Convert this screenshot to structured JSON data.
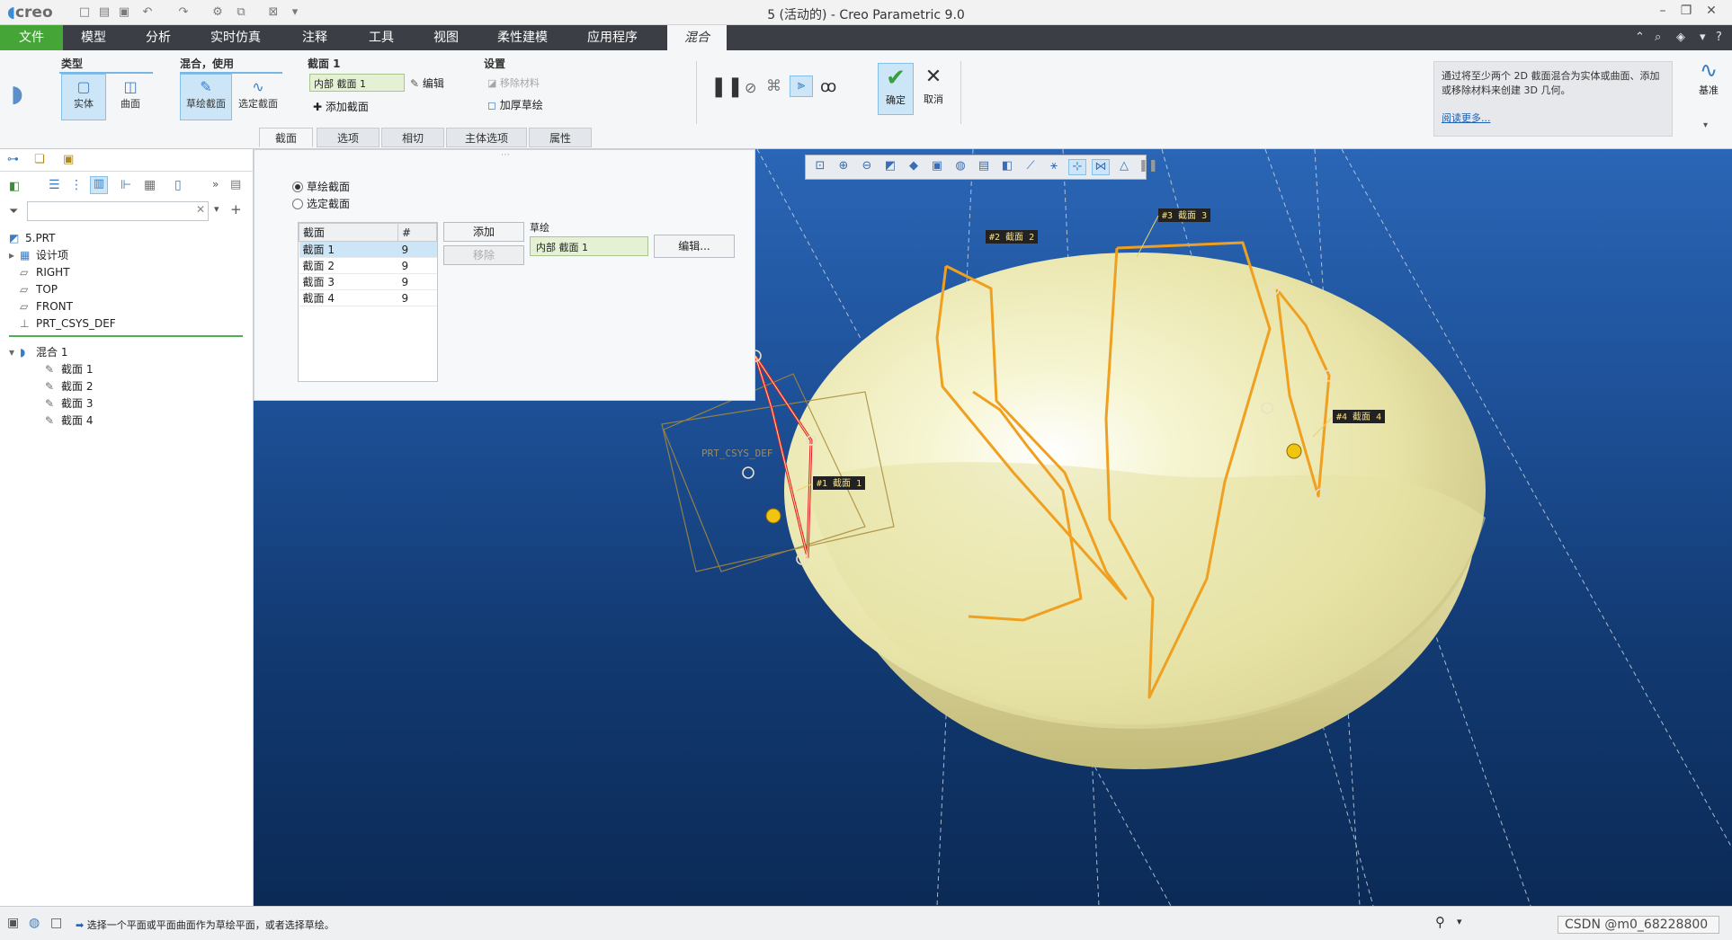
{
  "window": {
    "logo": "creo",
    "title": "5 (活动的) - Creo Parametric 9.0"
  },
  "menubar": {
    "items": [
      "文件",
      "模型",
      "分析",
      "实时仿真",
      "注释",
      "工具",
      "视图",
      "柔性建模",
      "应用程序",
      "混合"
    ],
    "active_index": 9
  },
  "ribbon": {
    "type_group": {
      "title": "类型",
      "solid": "实体",
      "surface": "曲面"
    },
    "blend_group": {
      "title": "混合，使用",
      "sketched": "草绘截面",
      "selected": "选定截面"
    },
    "section_group": {
      "title": "截面 1",
      "field_value": "内部 截面 1",
      "edit": "编辑",
      "add_section": "添加截面"
    },
    "settings_group": {
      "title": "设置",
      "remove_material": "移除材料",
      "thicken_sketch": "加厚草绘"
    },
    "confirm": "确定",
    "cancel": "取消",
    "help": {
      "text": "通过将至少两个 2D 截面混合为实体或曲面、添加或移除材料来创建 3D 几何。",
      "link": "阅读更多..."
    },
    "datum": "基准",
    "subtabs": [
      "截面",
      "选项",
      "相切",
      "主体选项",
      "属性"
    ],
    "subtab_active": 0
  },
  "model_tree": {
    "filter_placeholder": "",
    "items": [
      {
        "label": "5.PRT",
        "icon": "part-icon",
        "level": 0
      },
      {
        "label": "设计项",
        "icon": "design-items-icon",
        "level": 1
      },
      {
        "label": "RIGHT",
        "icon": "datum-plane-icon",
        "level": 1
      },
      {
        "label": "TOP",
        "icon": "datum-plane-icon",
        "level": 1
      },
      {
        "label": "FRONT",
        "icon": "datum-plane-icon",
        "level": 1
      },
      {
        "label": "PRT_CSYS_DEF",
        "icon": "csys-icon",
        "level": 1
      },
      {
        "label": "混合 1",
        "icon": "blend-icon",
        "level": 1
      },
      {
        "label": "截面 1",
        "icon": "sketch-icon",
        "level": 2
      },
      {
        "label": "截面 2",
        "icon": "sketch-icon",
        "level": 2
      },
      {
        "label": "截面 3",
        "icon": "sketch-icon",
        "level": 2
      },
      {
        "label": "截面 4",
        "icon": "sketch-icon",
        "level": 2
      }
    ]
  },
  "section_panel": {
    "radio_sketched": "草绘截面",
    "radio_selected": "选定截面",
    "table": {
      "headers": [
        "截面",
        "#"
      ],
      "rows": [
        [
          "截面 1",
          "9"
        ],
        [
          "截面 2",
          "9"
        ],
        [
          "截面 3",
          "9"
        ],
        [
          "截面 4",
          "9"
        ]
      ]
    },
    "add": "添加",
    "remove": "移除",
    "sketch_label": "草绘",
    "sketch_value": "内部 截面 1",
    "edit": "编辑..."
  },
  "viewport": {
    "csys_label": "PRT_CSYS_DEF",
    "section_tags": [
      "#1 截面 1",
      "#2 截面 2",
      "#3 截面 3",
      "#4 截面 4"
    ]
  },
  "status": {
    "message": "选择一个平面或平面曲面作为草绘平面，或者选择草绘。",
    "watermark": "CSDN @m0_68228800"
  }
}
